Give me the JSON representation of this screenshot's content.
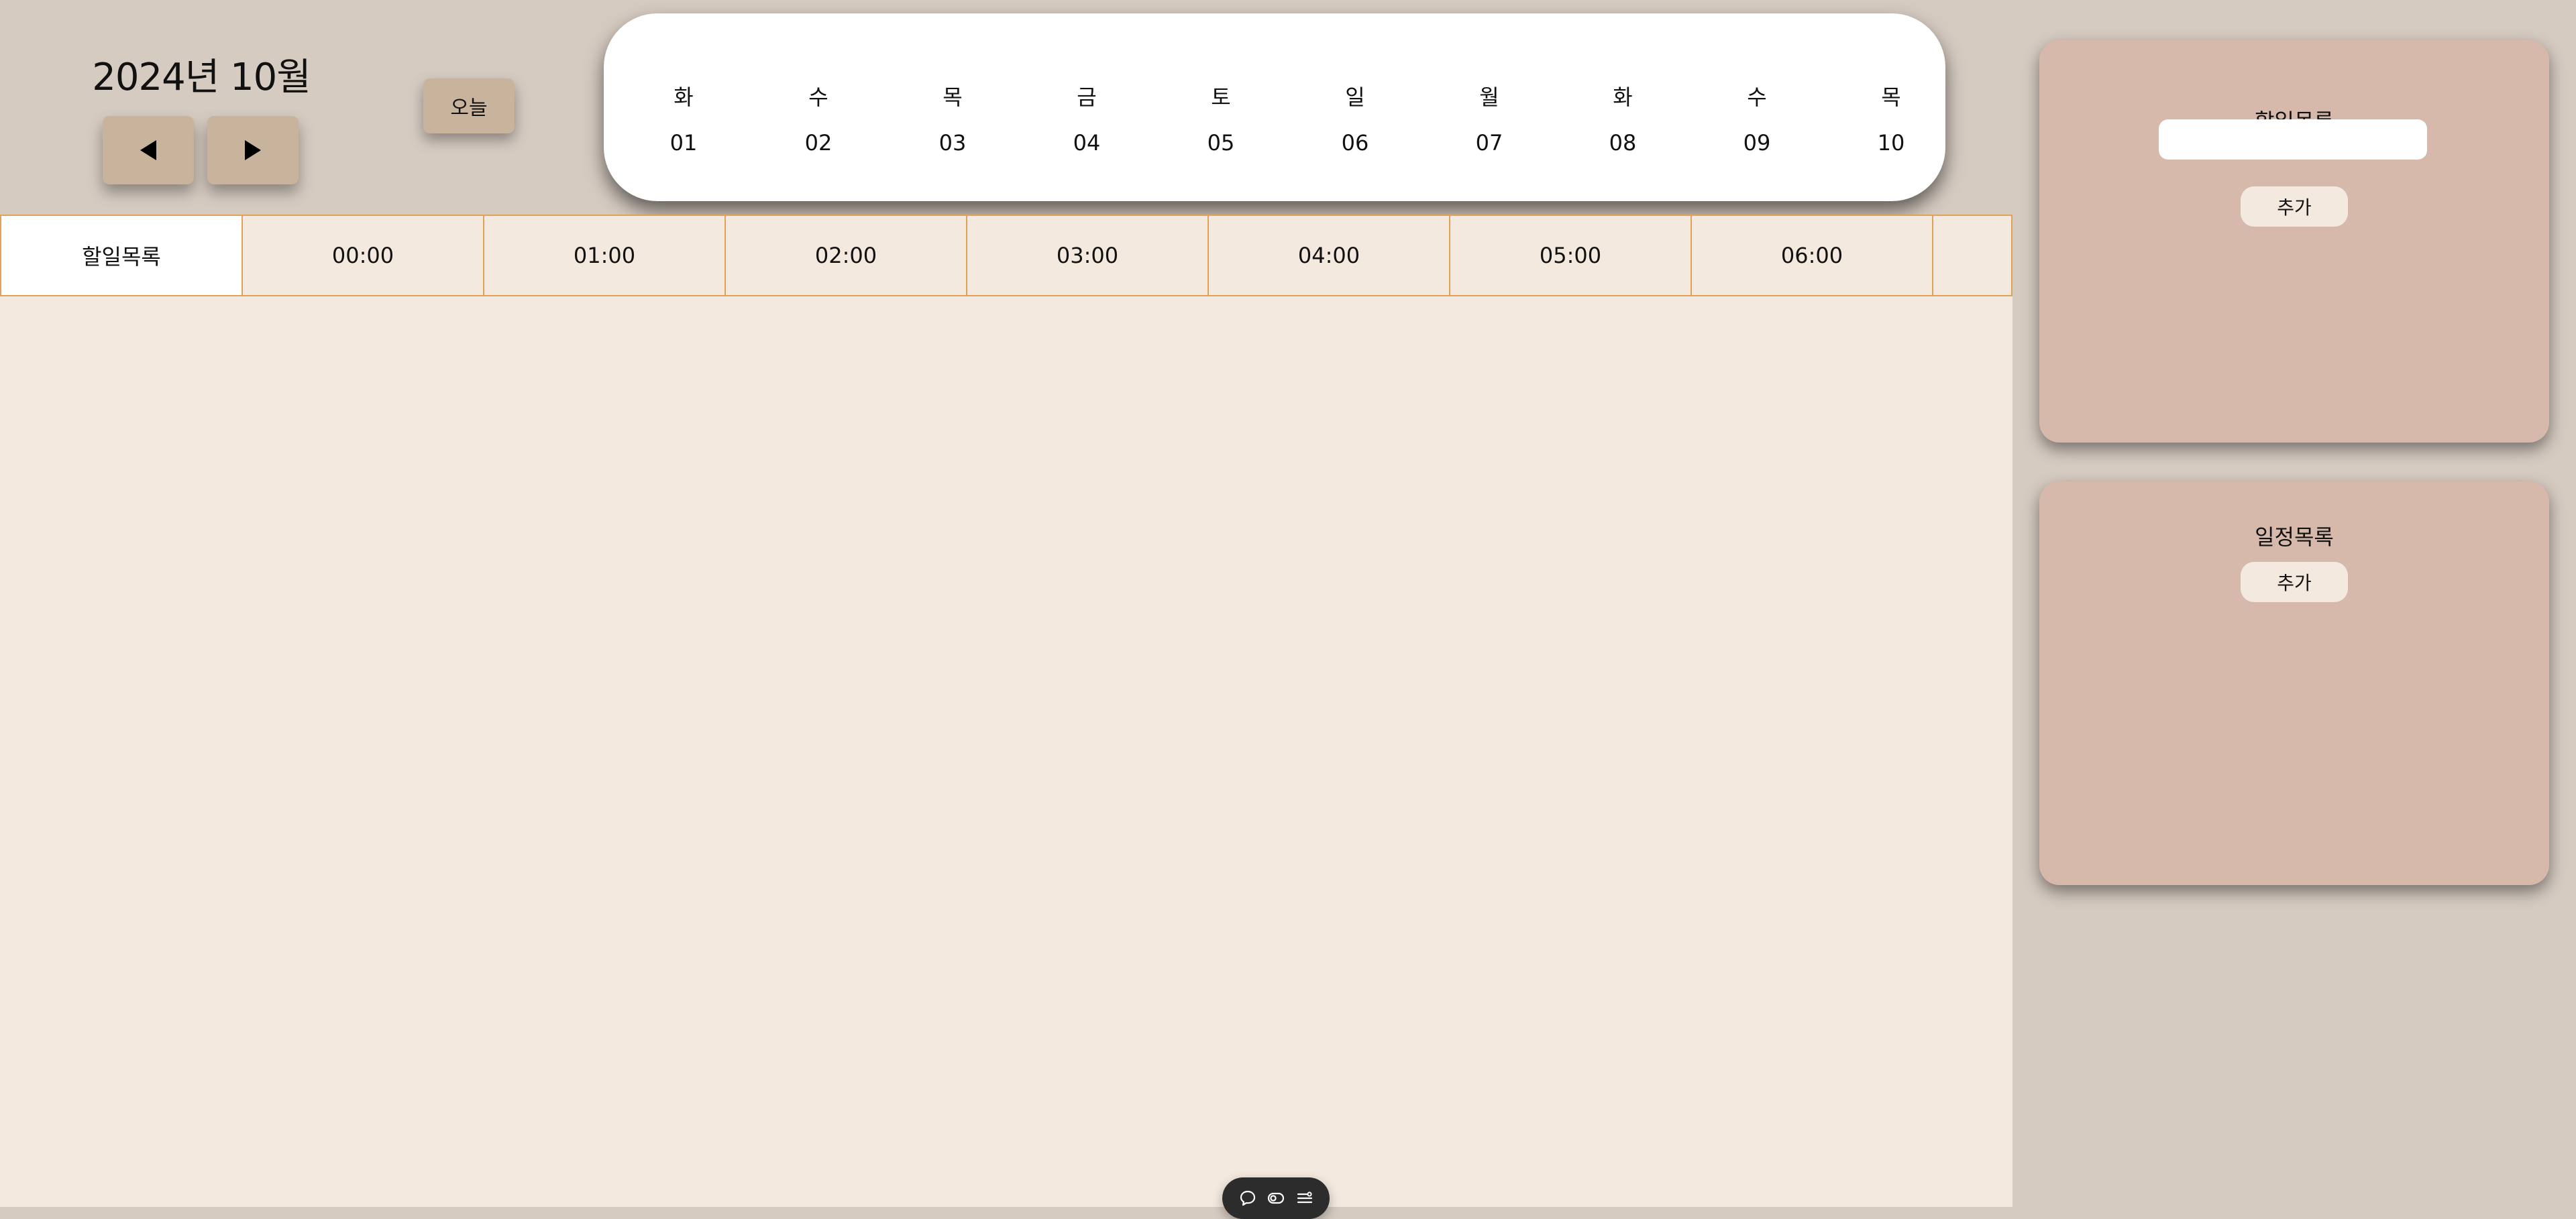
{
  "header": {
    "month_label": "2024년 10월",
    "today_label": "오늘",
    "prev_icon": "triangle-left-icon",
    "next_icon": "triangle-right-icon"
  },
  "date_strip": {
    "days": [
      {
        "dow": "화",
        "day": "01"
      },
      {
        "dow": "수",
        "day": "02"
      },
      {
        "dow": "목",
        "day": "03"
      },
      {
        "dow": "금",
        "day": "04"
      },
      {
        "dow": "토",
        "day": "05"
      },
      {
        "dow": "일",
        "day": "06"
      },
      {
        "dow": "월",
        "day": "07"
      },
      {
        "dow": "화",
        "day": "08"
      },
      {
        "dow": "수",
        "day": "09"
      },
      {
        "dow": "목",
        "day": "10"
      }
    ]
  },
  "timeline": {
    "first_column_label": "할일목록",
    "hours": [
      "00:00",
      "01:00",
      "02:00",
      "03:00",
      "04:00",
      "05:00",
      "06:00"
    ]
  },
  "toolbar": {
    "icons": [
      "chat-bubble-icon",
      "toggle-icon",
      "list-settings-icon"
    ]
  },
  "todo_panel": {
    "title": "할일목록",
    "input_value": "",
    "input_placeholder": "",
    "add_label": "추가"
  },
  "schedule_panel": {
    "title": "일정목록",
    "add_label": "추가"
  },
  "colors": {
    "page_bg": "#d6cbc1",
    "main_bg": "#f3e9df",
    "grid_border": "#e2a159",
    "button_bg": "#c8b49c",
    "panel_bg": "#d6b9ab",
    "toolbar_bg": "#2c2c2c"
  }
}
